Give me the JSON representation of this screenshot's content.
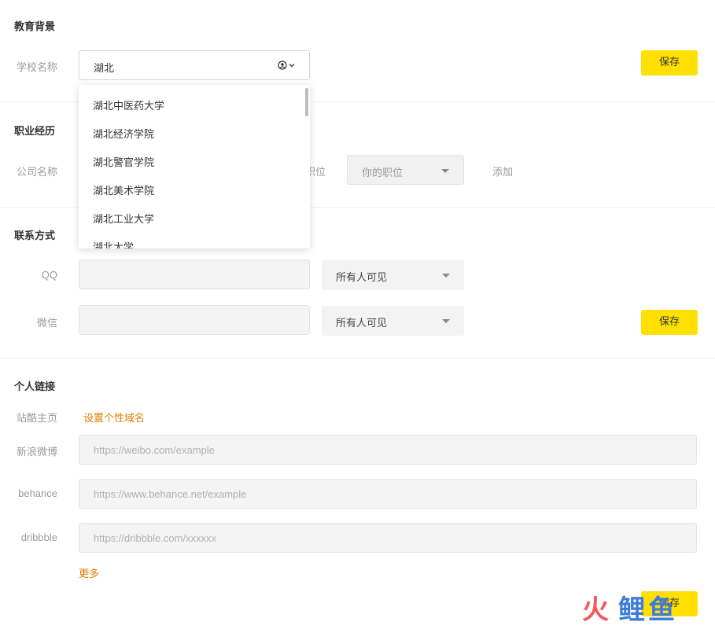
{
  "education": {
    "section_title": "教育背景",
    "school_label": "学校名称",
    "school_value": "湖北",
    "save_label": "保存",
    "dropdown_options": [
      "湖北中医药大学",
      "湖北经济学院",
      "湖北警官学院",
      "湖北美术学院",
      "湖北工业大学",
      "湖北大学"
    ]
  },
  "career": {
    "section_title": "职业经历",
    "company_label": "公司名称",
    "position_label": "职位",
    "position_placeholder": "你的职位",
    "add_label": "添加"
  },
  "contact": {
    "section_title": "联系方式",
    "qq_label": "QQ",
    "qq_visibility": "所有人可见",
    "wechat_label": "微信",
    "wechat_visibility": "所有人可见",
    "save_label": "保存"
  },
  "links": {
    "section_title": "个人链接",
    "zcool_label": "站酷主页",
    "zcool_action": "设置个性域名",
    "weibo_label": "新浪微博",
    "weibo_placeholder": "https://weibo.com/example",
    "behance_label": "behance",
    "behance_placeholder": "https://www.behance.net/example",
    "dribbble_label": "dribbble",
    "dribbble_placeholder": "https://dribbble.com/xxxxxx",
    "more_label": "更多",
    "save_label": "保存"
  },
  "watermark": {
    "text_left": "火",
    "text_right": "鲤鱼"
  },
  "colors": {
    "accent_yellow": "#ffe000",
    "link_orange": "#e07b00"
  }
}
